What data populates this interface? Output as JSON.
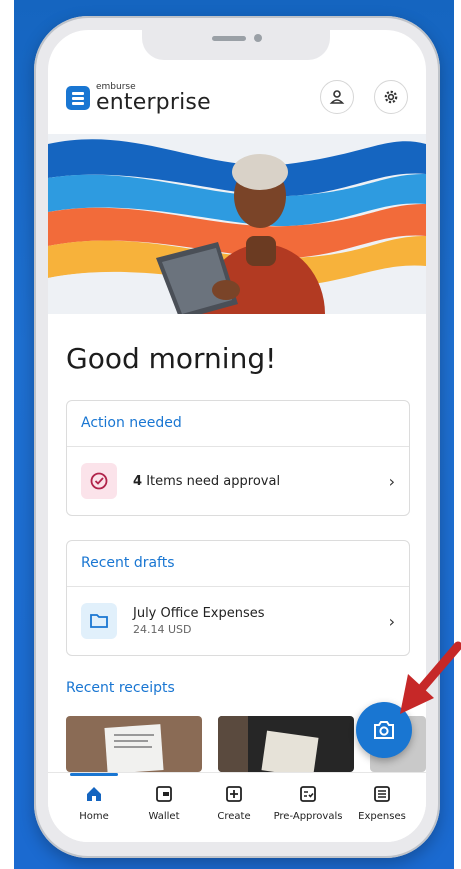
{
  "app": {
    "brand_small": "emburse",
    "brand_big": "enterprise"
  },
  "header": {
    "profile_icon": "user-icon",
    "settings_icon": "gear-icon"
  },
  "greeting": "Good morning!",
  "action_card": {
    "title": "Action needed",
    "count": "4",
    "text": "Items need approval"
  },
  "drafts_card": {
    "title": "Recent drafts",
    "name": "July Office Expenses",
    "amount": "24.14 USD"
  },
  "receipts": {
    "title": "Recent receipts"
  },
  "tabs": [
    {
      "label": "Home",
      "icon": "home-icon"
    },
    {
      "label": "Wallet",
      "icon": "wallet-icon"
    },
    {
      "label": "Create",
      "icon": "plus-square-icon"
    },
    {
      "label": "Pre-Approvals",
      "icon": "checklist-icon"
    },
    {
      "label": "Expenses",
      "icon": "list-icon"
    }
  ],
  "colors": {
    "accent": "#1976d2",
    "background": "#1565c0",
    "arrow": "#c62828"
  }
}
